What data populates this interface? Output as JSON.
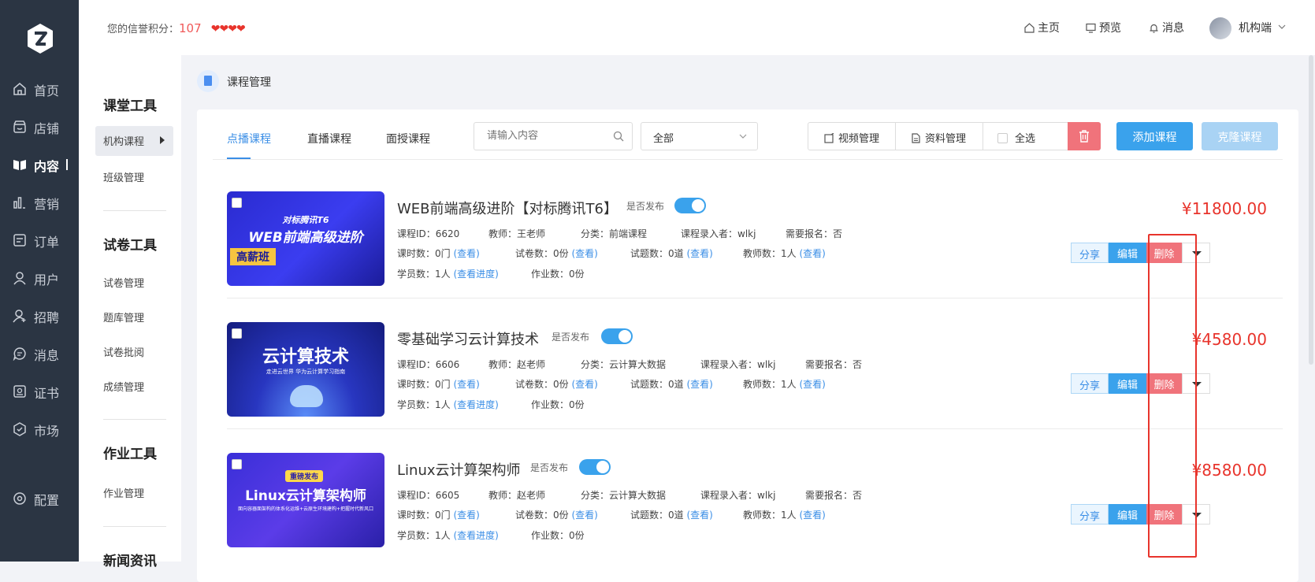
{
  "topbar": {
    "credit_label": "您的信誉积分：",
    "credit_value": "107",
    "hearts": "❤❤❤❤",
    "links": {
      "home": "主页",
      "preview": "预览",
      "message": "消息"
    },
    "user_label": "机构端"
  },
  "nav": {
    "items": [
      {
        "label": "首页",
        "icon": "home-icon"
      },
      {
        "label": "店铺",
        "icon": "shop-icon"
      },
      {
        "label": "内容",
        "icon": "book-icon"
      },
      {
        "label": "营销",
        "icon": "chart-icon"
      },
      {
        "label": "订单",
        "icon": "order-icon"
      },
      {
        "label": "用户",
        "icon": "user-icon"
      },
      {
        "label": "招聘",
        "icon": "recruit-icon"
      },
      {
        "label": "消息",
        "icon": "chat-icon"
      },
      {
        "label": "证书",
        "icon": "certificate-icon"
      },
      {
        "label": "市场",
        "icon": "market-icon"
      },
      {
        "label": "配置",
        "icon": "gear-icon"
      }
    ],
    "active_index": 2
  },
  "sidebar": {
    "sections": [
      {
        "title": "课堂工具",
        "items": [
          "机构课程",
          "班级管理"
        ]
      },
      {
        "title": "试卷工具",
        "items": [
          "试卷管理",
          "题库管理",
          "试卷批阅",
          "成绩管理"
        ]
      },
      {
        "title": "作业工具",
        "items": [
          "作业管理"
        ]
      },
      {
        "title": "新闻资讯",
        "items": []
      }
    ]
  },
  "breadcrumb": "课程管理",
  "tabs": [
    "点播课程",
    "直播课程",
    "面授课程"
  ],
  "search": {
    "placeholder": "请输入内容"
  },
  "filter": {
    "selected": "全部"
  },
  "toolbar": {
    "video": "视频管理",
    "material": "资料管理",
    "select_all": "全选",
    "add": "添加课程",
    "clone": "克隆课程"
  },
  "labels": {
    "published": "是否发布",
    "course_id": "课程ID：",
    "teacher": "教师：",
    "category": "分类：",
    "recorder": "课程录入者：",
    "signup": "需要报名：",
    "lessons": "课时数：",
    "papers": "试卷数：",
    "questions": "试题数：",
    "teachers": "教师数：",
    "students": "学员数：",
    "homework": "作业数：",
    "view": "(查看)",
    "view_progress": "(查看进度)",
    "share": "分享",
    "edit": "编辑",
    "delete": "删除"
  },
  "courses": [
    {
      "title": "WEB前端高级进阶【对标腾讯T6】",
      "course_id": "6620",
      "teacher": "王老师",
      "category": "前端课程",
      "recorder": "wlkj",
      "signup": "否",
      "lessons": "0门",
      "papers": "0份",
      "questions": "0道",
      "teachers": "1人",
      "students": "1人",
      "homework": "0份",
      "price": "¥11800.00",
      "thumb": {
        "line1": "对标腾讯T6",
        "line2": "WEB前端高级进阶",
        "line3": "高薪班"
      }
    },
    {
      "title": "零基础学习云计算技术",
      "course_id": "6606",
      "teacher": "赵老师",
      "category": "云计算大数据",
      "recorder": "wlkj",
      "signup": "否",
      "lessons": "0门",
      "papers": "0份",
      "questions": "0道",
      "teachers": "1人",
      "students": "1人",
      "homework": "0份",
      "price": "¥4580.00",
      "thumb": {
        "line1": "云计算技术",
        "line2": "走进云世界 华为云计算学习指南",
        "line3": ""
      }
    },
    {
      "title": "Linux云计算架构师",
      "course_id": "6605",
      "teacher": "赵老师",
      "category": "云计算大数据",
      "recorder": "wlkj",
      "signup": "否",
      "lessons": "0门",
      "papers": "0份",
      "questions": "0道",
      "teachers": "1人",
      "students": "1人",
      "homework": "0份",
      "price": "¥8580.00",
      "thumb": {
        "line1": "重磅发布",
        "line2": "Linux云计算架构师",
        "line3": "面向容器面架构的体系化运维+云原生环境建构+把握时代新风口"
      }
    }
  ]
}
